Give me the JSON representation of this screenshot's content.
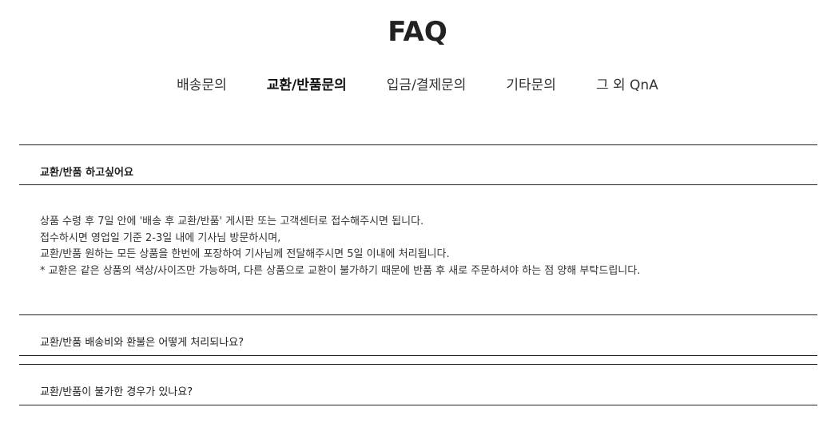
{
  "page": {
    "title": "FAQ"
  },
  "tabs": [
    {
      "label": "배송문의",
      "active": false
    },
    {
      "label": "교환/반품문의",
      "active": true
    },
    {
      "label": "입금/결제문의",
      "active": false
    },
    {
      "label": "기타문의",
      "active": false
    },
    {
      "label": "그 외 QnA",
      "active": false
    }
  ],
  "faq": [
    {
      "question": "교환/반품 하고싶어요",
      "open": true,
      "answer": [
        "상품 수령 후 7일 안에 '배송 후 교환/반품' 게시판 또는 고객센터로 접수해주시면 됩니다.",
        "접수하시면 영업일 기준 2-3일 내에 기사님 방문하시며,",
        "교환/반품 원하는 모든 상품을 한번에 포장하여 기사님께 전달해주시면 5일 이내에 처리됩니다.",
        "* 교환은 같은 상품의 색상/사이즈만 가능하며, 다른 상품으로 교환이 불가하기 때문에 반품 후 새로 주문하셔야 하는 점 양해 부탁드립니다."
      ]
    },
    {
      "question": "교환/반품 배송비와 환불은 어떻게 처리되나요?",
      "open": false
    },
    {
      "question": "교환/반품이 불가한 경우가 있나요?",
      "open": false
    }
  ]
}
